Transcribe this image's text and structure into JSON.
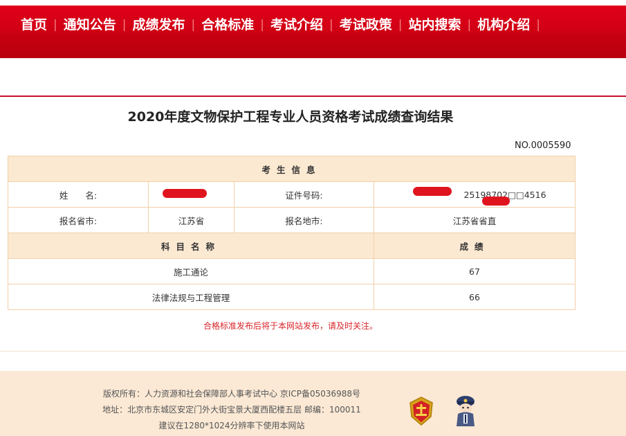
{
  "nav": {
    "items": [
      "首页",
      "通知公告",
      "成绩发布",
      "合格标准",
      "考试介绍",
      "考试政策",
      "站内搜索",
      "机构介绍"
    ],
    "separator": "|"
  },
  "page": {
    "title": "2020年度文物保护工程专业人员资格考试成绩查询结果",
    "serial_no": "NO.0005590"
  },
  "table": {
    "section_examinee": "考生信息",
    "name_label": "姓　　名:",
    "name_value": "",
    "id_label": "证件号码:",
    "id_value": "25198702□□4516",
    "province_label": "报名省市:",
    "province_value": "江苏省",
    "city_label": "报名地市:",
    "city_value": "江苏省省直",
    "subject_header": "科目名称",
    "score_header": "成绩",
    "rows": [
      {
        "subject": "施工通论",
        "score": "67"
      },
      {
        "subject": "法律法规与工程管理",
        "score": "66"
      }
    ]
  },
  "note": "合格标准发布后将于本网站发布，请及时关注。",
  "footer": {
    "line1": "版权所有：人力资源和社会保障部人事考试中心  京ICP备05036988号",
    "line2": "地址：北京市东城区安定门外大街宝景大厦西配楼五层  邮编：100011",
    "line3": "建议在1280*1024分辨率下使用本网站"
  },
  "colors": {
    "nav_red": "#d8001a",
    "header_fill": "#fce9d2",
    "note_red": "#d9252a",
    "footer_bg": "#fbe9d5"
  }
}
